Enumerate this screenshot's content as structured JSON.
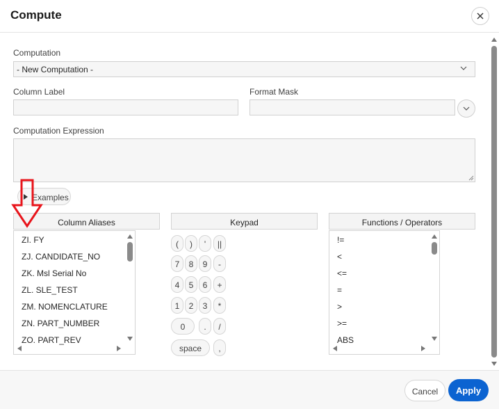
{
  "dialog": {
    "title": "Compute"
  },
  "computation": {
    "label": "Computation",
    "value": "- New Computation -"
  },
  "column_label": {
    "label": "Column Label",
    "value": ""
  },
  "format_mask": {
    "label": "Format Mask",
    "value": ""
  },
  "expression": {
    "label": "Computation Expression",
    "value": ""
  },
  "examples": {
    "label": "Examples"
  },
  "column_aliases": {
    "header": "Column Aliases",
    "items": [
      "ZI. FY",
      "ZJ. CANDIDATE_NO",
      "ZK. Msl Serial No",
      "ZL. SLE_TEST",
      "ZM. NOMENCLATURE",
      "ZN. PART_NUMBER",
      "ZO. PART_REV"
    ]
  },
  "keypad": {
    "header": "Keypad",
    "keys": [
      "(",
      ")",
      "'",
      "||",
      "7",
      "8",
      "9",
      "-",
      "4",
      "5",
      "6",
      "+",
      "1",
      "2",
      "3",
      "*",
      "0",
      ".",
      "/",
      "space",
      ","
    ]
  },
  "functions": {
    "header": "Functions / Operators",
    "items": [
      "!=",
      "<",
      "<=",
      "=",
      ">",
      ">=",
      "ABS"
    ]
  },
  "footer": {
    "cancel": "Cancel",
    "apply": "Apply"
  },
  "colors": {
    "accent": "#0b63d1",
    "annotation": "#e8141b"
  },
  "icons": {
    "close": "close-icon",
    "select": "chevron-down-icon",
    "format_mask": "chevron-down-icon",
    "examples": "triangle-right-icon"
  }
}
